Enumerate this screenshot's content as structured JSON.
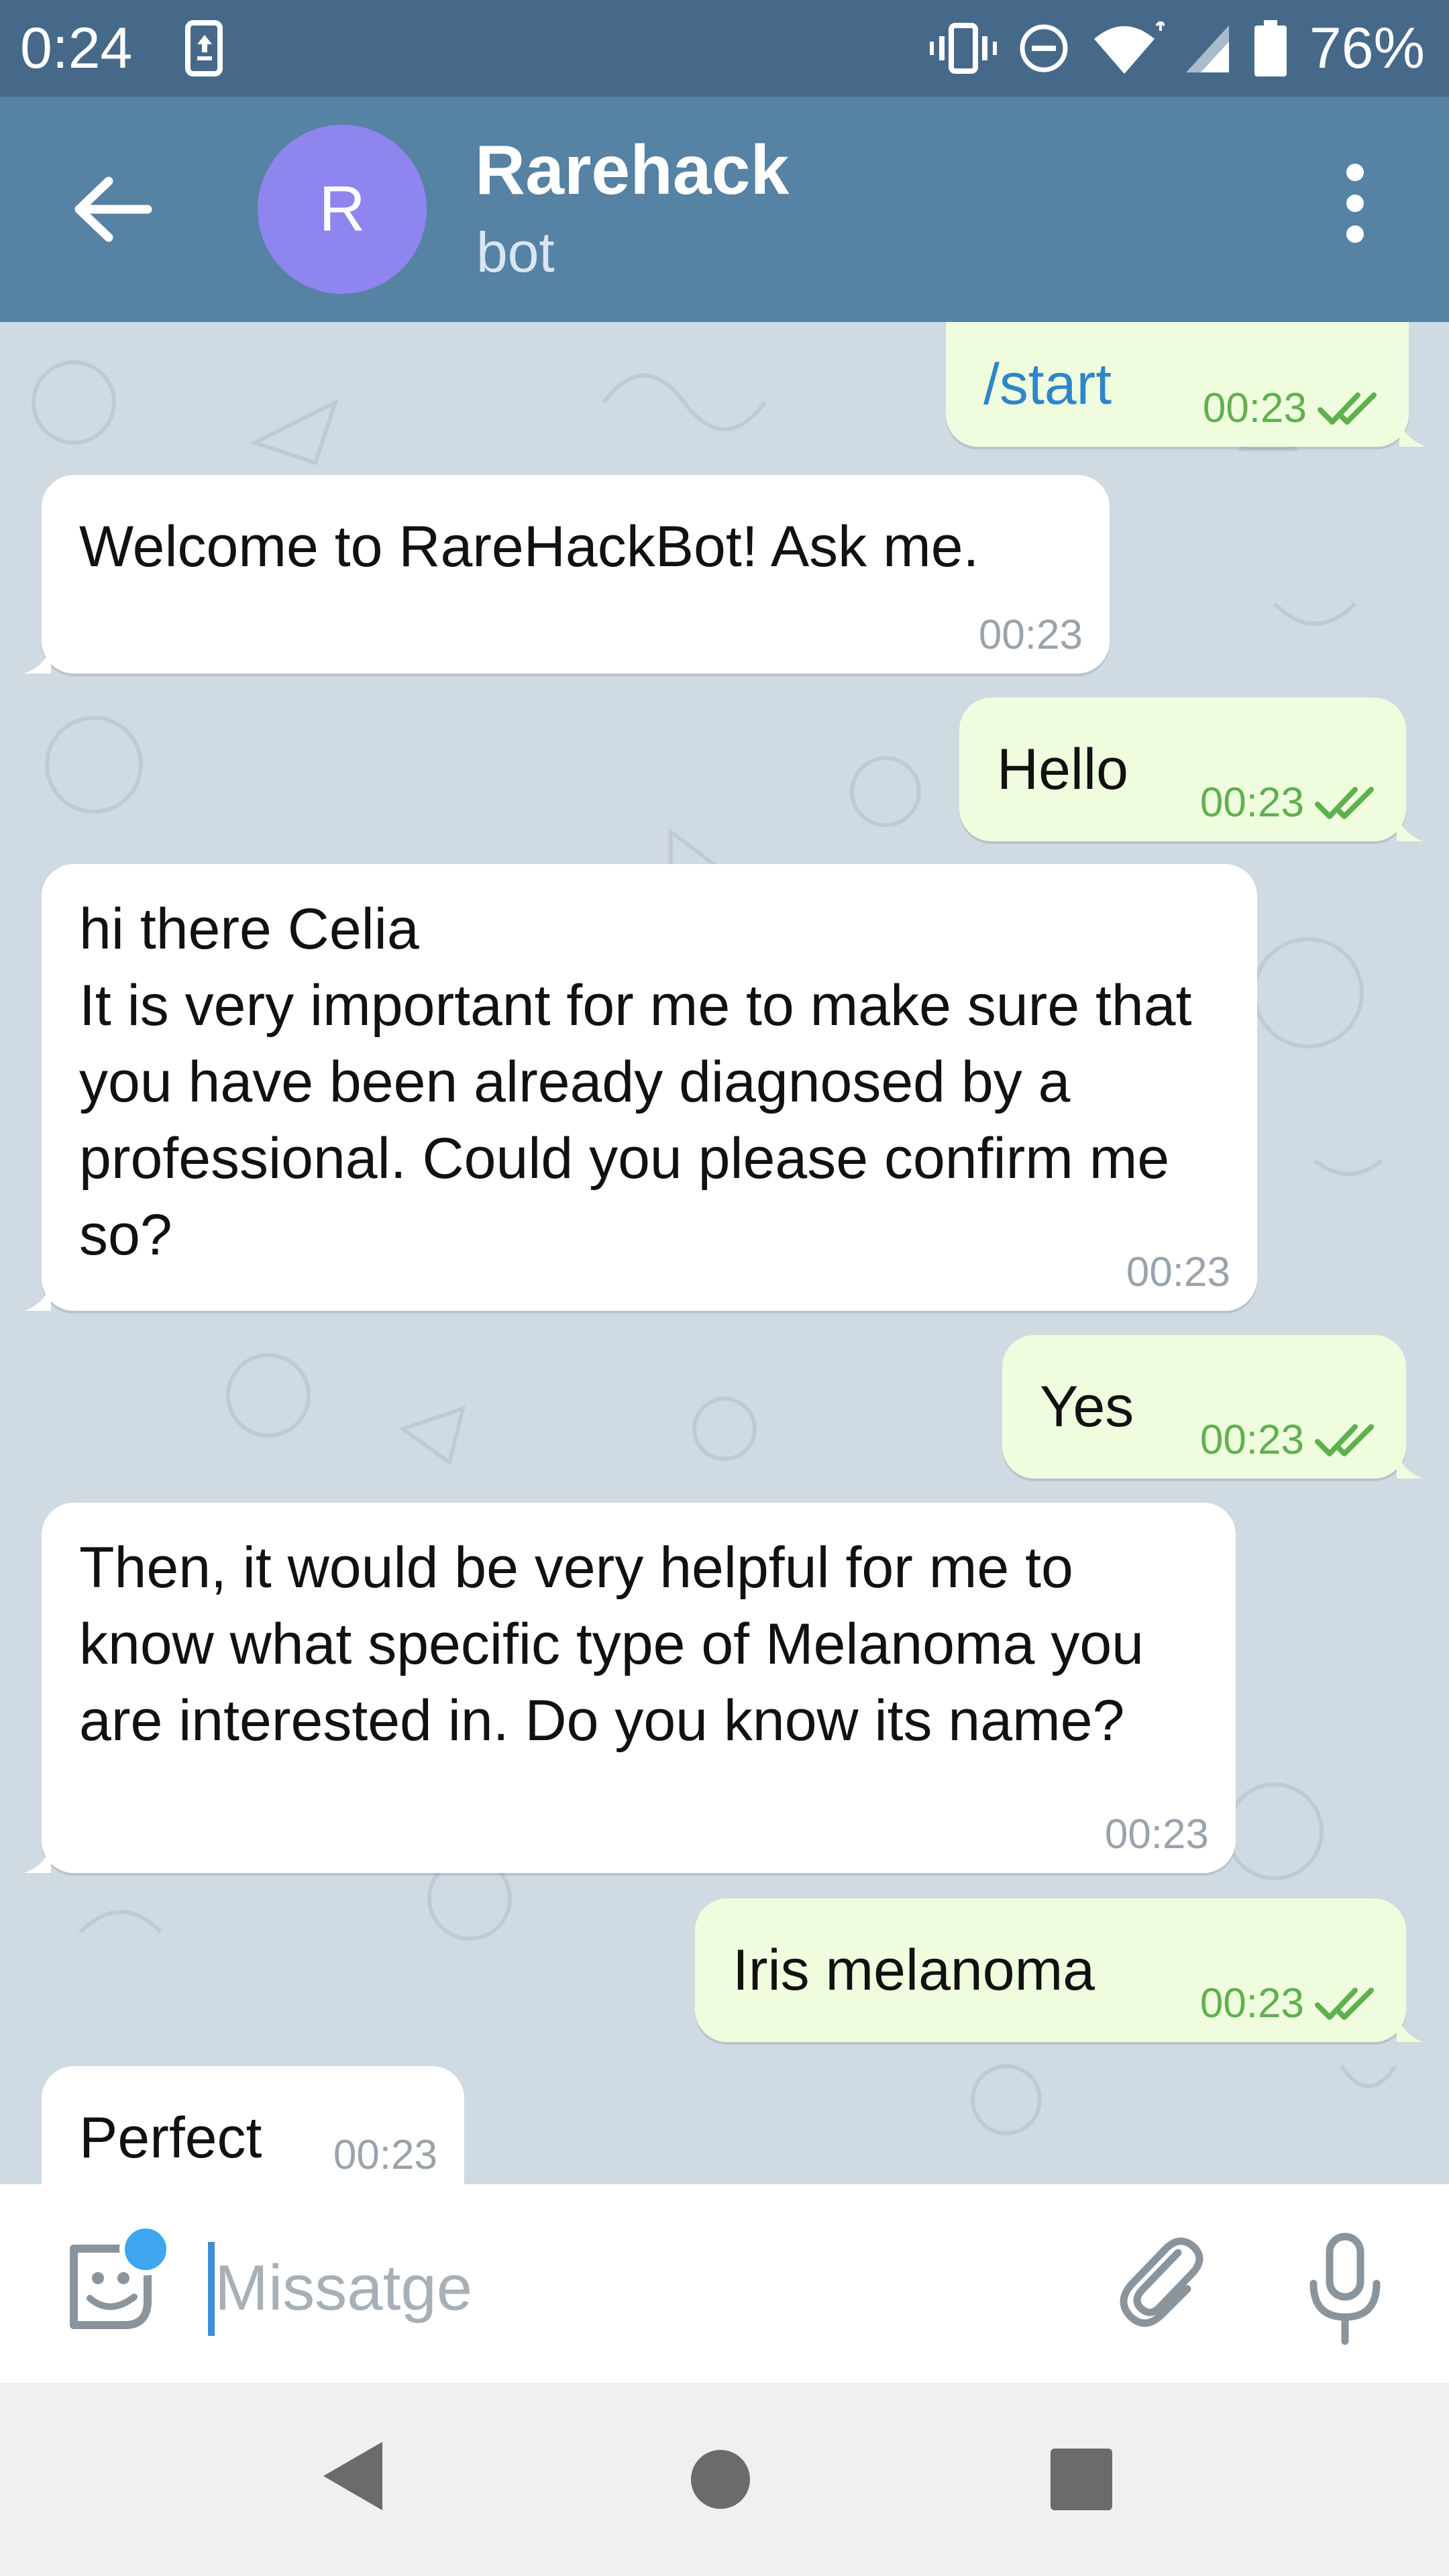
{
  "status_bar": {
    "time": "0:24",
    "battery_percent": "76%"
  },
  "header": {
    "avatar_letter": "R",
    "title": "Rarehack",
    "subtitle": "bot"
  },
  "messages": [
    {
      "direction": "out",
      "text": "/start",
      "time": "00:23",
      "read": true
    },
    {
      "direction": "in",
      "text": "Welcome to RareHackBot! Ask me.",
      "time": "00:23"
    },
    {
      "direction": "out",
      "text": "Hello",
      "time": "00:23",
      "read": true
    },
    {
      "direction": "in",
      "text": "hi there Celia\nIt is very important for me to make sure that you have been already diagnosed by a professional. Could you please confirm me so?",
      "time": "00:23"
    },
    {
      "direction": "out",
      "text": "Yes",
      "time": "00:23",
      "read": true
    },
    {
      "direction": "in",
      "text": "Then, it would be very helpful for me to know what specific type of Melanoma you are interested in. Do you know its name?",
      "time": "00:23"
    },
    {
      "direction": "out",
      "text": "Iris melanoma",
      "time": "00:23",
      "read": true
    },
    {
      "direction": "in",
      "text": "Perfect",
      "time": "00:23"
    }
  ],
  "composer": {
    "placeholder": "Missatge",
    "value": ""
  },
  "colors": {
    "status_bar": "#46698a",
    "header": "#5682a3",
    "incoming": "#ffffff",
    "outgoing": "#effdde",
    "avatar": "#8e85ee",
    "time_out": "#5fb14e"
  },
  "icons": [
    "back-arrow-icon",
    "more-vert-icon",
    "sticker-icon",
    "attach-icon",
    "mic-icon",
    "nav-back-icon",
    "nav-home-icon",
    "nav-recents-icon"
  ]
}
